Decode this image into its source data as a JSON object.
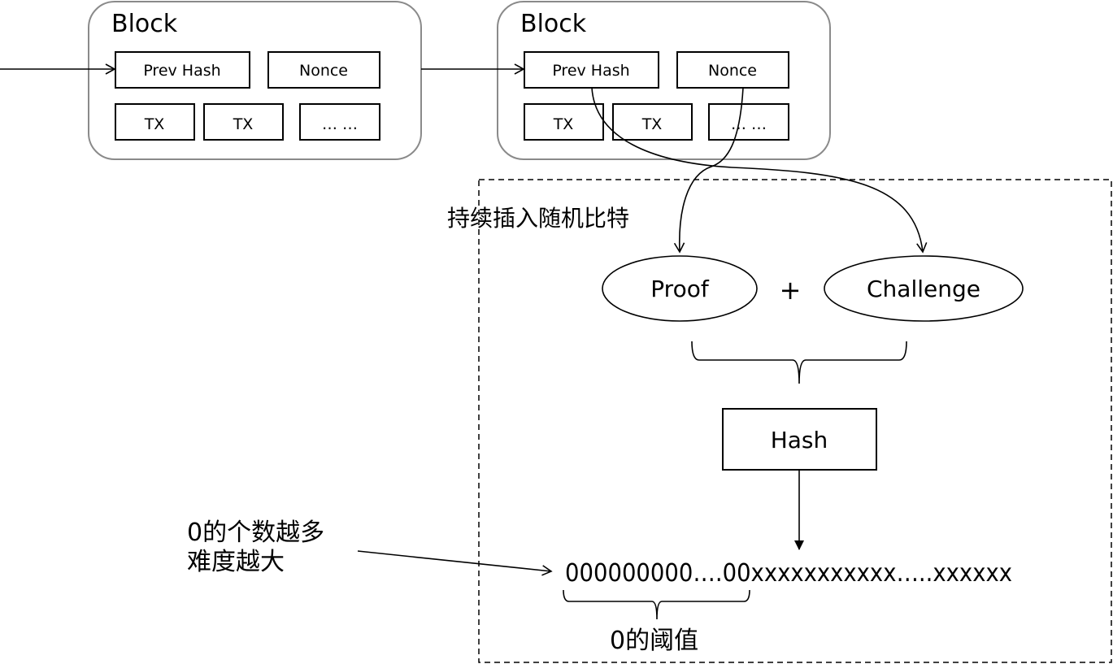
{
  "blocks": [
    {
      "title": "Block",
      "prev_hash": "Prev Hash",
      "nonce": "Nonce",
      "tx1": "TX",
      "tx2": "TX",
      "more": "… …"
    },
    {
      "title": "Block",
      "prev_hash": "Prev Hash",
      "nonce": "Nonce",
      "tx1": "TX",
      "tx2": "TX",
      "more": "… …"
    }
  ],
  "insert_label": "持续插入随机比特",
  "proof": "Proof",
  "plus": "+",
  "challenge": "Challenge",
  "hash": "Hash",
  "hash_output": "000000000….00xxxxxxxxxxx…..xxxxxx",
  "threshold_label": "0的阈值",
  "difficulty_note": [
    "0的个数越多",
    "难度越大"
  ]
}
